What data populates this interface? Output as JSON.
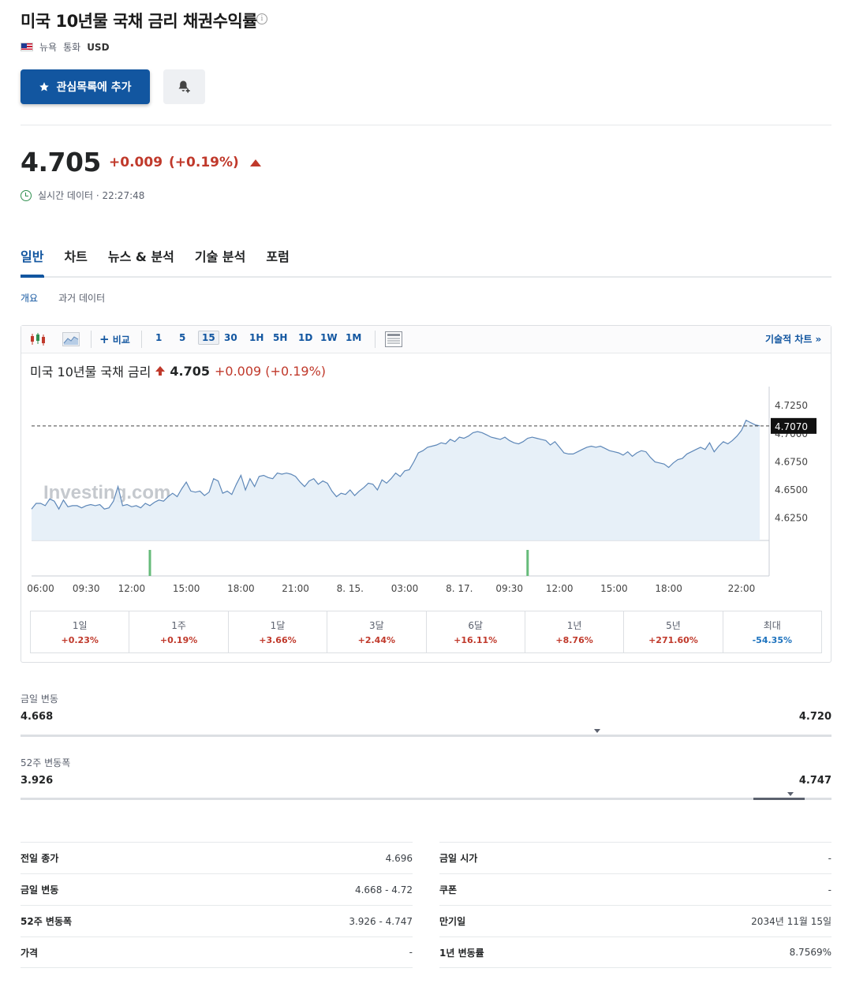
{
  "header": {
    "title": "미국 10년물 국채 금리 채권수익률",
    "location": "뉴욕",
    "currency_label": "통화",
    "currency": "USD",
    "watchlist_button": "관심목록에 추가"
  },
  "quote": {
    "price": "4.705",
    "change": "+0.009",
    "change_pct": "(+0.19%)",
    "realtime_text": "실시간 데이터 · 22:27:48"
  },
  "tabs": [
    "일반",
    "차트",
    "뉴스 & 분석",
    "기술 분석",
    "포럼"
  ],
  "subtabs": [
    "개요",
    "과거 데이터"
  ],
  "toolbar": {
    "compare": "비교",
    "intervals": [
      "1",
      "5",
      "15",
      "30",
      "1H",
      "5H",
      "1D",
      "1W",
      "1M"
    ],
    "selected_interval": "15",
    "technical_chart": "기술적 차트 »"
  },
  "chart_header": {
    "name": "미국 10년물 국채 금리",
    "price": "4.705",
    "change": "+0.009 (+0.19%)"
  },
  "chart_data": {
    "type": "area",
    "watermark": "Investing.com",
    "current_label": "4.7070",
    "current_value": 4.707,
    "ylim": [
      4.605,
      4.735
    ],
    "y_ticks": [
      {
        "v": 4.725,
        "label": "4.7250"
      },
      {
        "v": 4.7,
        "label": "4.7000"
      },
      {
        "v": 4.675,
        "label": "4.6750"
      },
      {
        "v": 4.65,
        "label": "4.6500"
      },
      {
        "v": 4.625,
        "label": "4.6250"
      }
    ],
    "x_ticks": [
      {
        "i": 2,
        "label": "06:00"
      },
      {
        "i": 12,
        "label": "09:30"
      },
      {
        "i": 22,
        "label": "12:00"
      },
      {
        "i": 34,
        "label": "15:00"
      },
      {
        "i": 46,
        "label": "18:00"
      },
      {
        "i": 58,
        "label": "21:00"
      },
      {
        "i": 70,
        "label": "8. 15."
      },
      {
        "i": 82,
        "label": "03:00"
      },
      {
        "i": 94,
        "label": "8. 17."
      },
      {
        "i": 105,
        "label": "09:30"
      },
      {
        "i": 116,
        "label": "12:00"
      },
      {
        "i": 128,
        "label": "15:00"
      },
      {
        "i": 140,
        "label": "18:00"
      },
      {
        "i": 156,
        "label": "22:00"
      }
    ],
    "x_count": 161,
    "values": [
      4.633,
      4.638,
      4.638,
      4.636,
      4.642,
      4.64,
      4.633,
      4.641,
      4.635,
      4.636,
      4.636,
      4.634,
      4.636,
      4.637,
      4.636,
      4.637,
      4.633,
      4.634,
      4.64,
      4.653,
      4.636,
      4.637,
      4.635,
      4.636,
      4.634,
      4.638,
      4.636,
      4.639,
      4.641,
      4.64,
      4.644,
      4.647,
      4.644,
      4.651,
      4.657,
      4.649,
      4.648,
      4.649,
      4.645,
      4.648,
      4.66,
      4.658,
      4.647,
      4.649,
      4.646,
      4.655,
      4.663,
      4.65,
      4.66,
      4.653,
      4.662,
      4.663,
      4.661,
      4.66,
      4.665,
      4.664,
      4.665,
      4.664,
      4.662,
      4.657,
      4.653,
      4.658,
      4.66,
      4.655,
      4.658,
      4.656,
      4.649,
      4.644,
      4.647,
      4.646,
      4.65,
      4.645,
      4.649,
      4.652,
      4.656,
      4.655,
      4.65,
      4.659,
      4.656,
      4.66,
      4.665,
      4.662,
      4.667,
      4.668,
      4.675,
      4.683,
      4.685,
      4.688,
      4.689,
      4.69,
      4.692,
      4.691,
      4.695,
      4.693,
      4.697,
      4.696,
      4.698,
      4.701,
      4.702,
      4.701,
      4.699,
      4.697,
      4.696,
      4.695,
      4.697,
      4.694,
      4.692,
      4.691,
      4.693,
      4.696,
      4.697,
      4.696,
      4.695,
      4.694,
      4.69,
      4.693,
      4.688,
      4.683,
      4.682,
      4.682,
      4.684,
      4.686,
      4.688,
      4.689,
      4.688,
      4.689,
      4.687,
      4.685,
      4.684,
      4.683,
      4.681,
      4.684,
      4.68,
      4.683,
      4.685,
      4.684,
      4.679,
      4.675,
      4.674,
      4.673,
      4.67,
      4.674,
      4.677,
      4.678,
      4.682,
      4.684,
      4.686,
      4.688,
      4.686,
      4.692,
      4.684,
      4.689,
      4.693,
      4.691,
      4.694,
      4.698,
      4.703,
      4.712,
      4.71,
      4.708,
      4.707
    ],
    "volume_bars": [
      {
        "i": 26,
        "v": 1
      },
      {
        "i": 109,
        "v": 1
      }
    ]
  },
  "periods": [
    {
      "label": "1일",
      "value": "+0.23%",
      "dir": "pos"
    },
    {
      "label": "1주",
      "value": "+0.19%",
      "dir": "pos"
    },
    {
      "label": "1달",
      "value": "+3.66%",
      "dir": "pos"
    },
    {
      "label": "3달",
      "value": "+2.44%",
      "dir": "pos"
    },
    {
      "label": "6달",
      "value": "+16.11%",
      "dir": "pos"
    },
    {
      "label": "1년",
      "value": "+8.76%",
      "dir": "pos"
    },
    {
      "label": "5년",
      "value": "+271.60%",
      "dir": "pos"
    },
    {
      "label": "최대",
      "value": "-54.35%",
      "dir": "neg"
    }
  ],
  "day_range": {
    "label": "금일 변동",
    "low": "4.668",
    "high": "4.720",
    "marker_pct": 71.1
  },
  "week52_range": {
    "label": "52주 변동폭",
    "low": "3.926",
    "high": "4.747",
    "marker_pct": 94.9
  },
  "stats_left": [
    {
      "k": "전일 종가",
      "v": "4.696"
    },
    {
      "k": "금일 변동",
      "v": "4.668 - 4.72"
    },
    {
      "k": "52주 변동폭",
      "v": "3.926 - 4.747"
    },
    {
      "k": "가격",
      "v": "-"
    }
  ],
  "stats_right": [
    {
      "k": "금일 시가",
      "v": "-"
    },
    {
      "k": "쿠폰",
      "v": "-"
    },
    {
      "k": "만기일",
      "v": "2034년 11월 15일"
    },
    {
      "k": "1년 변동률",
      "v": "8.7569%"
    }
  ],
  "colors": {
    "accent": "#1256a0",
    "positive": "#c0392b",
    "negative": "#1e73be",
    "area_fill": "#e4eef7",
    "line": "#5d87b8",
    "volume": "#66bb7a"
  }
}
